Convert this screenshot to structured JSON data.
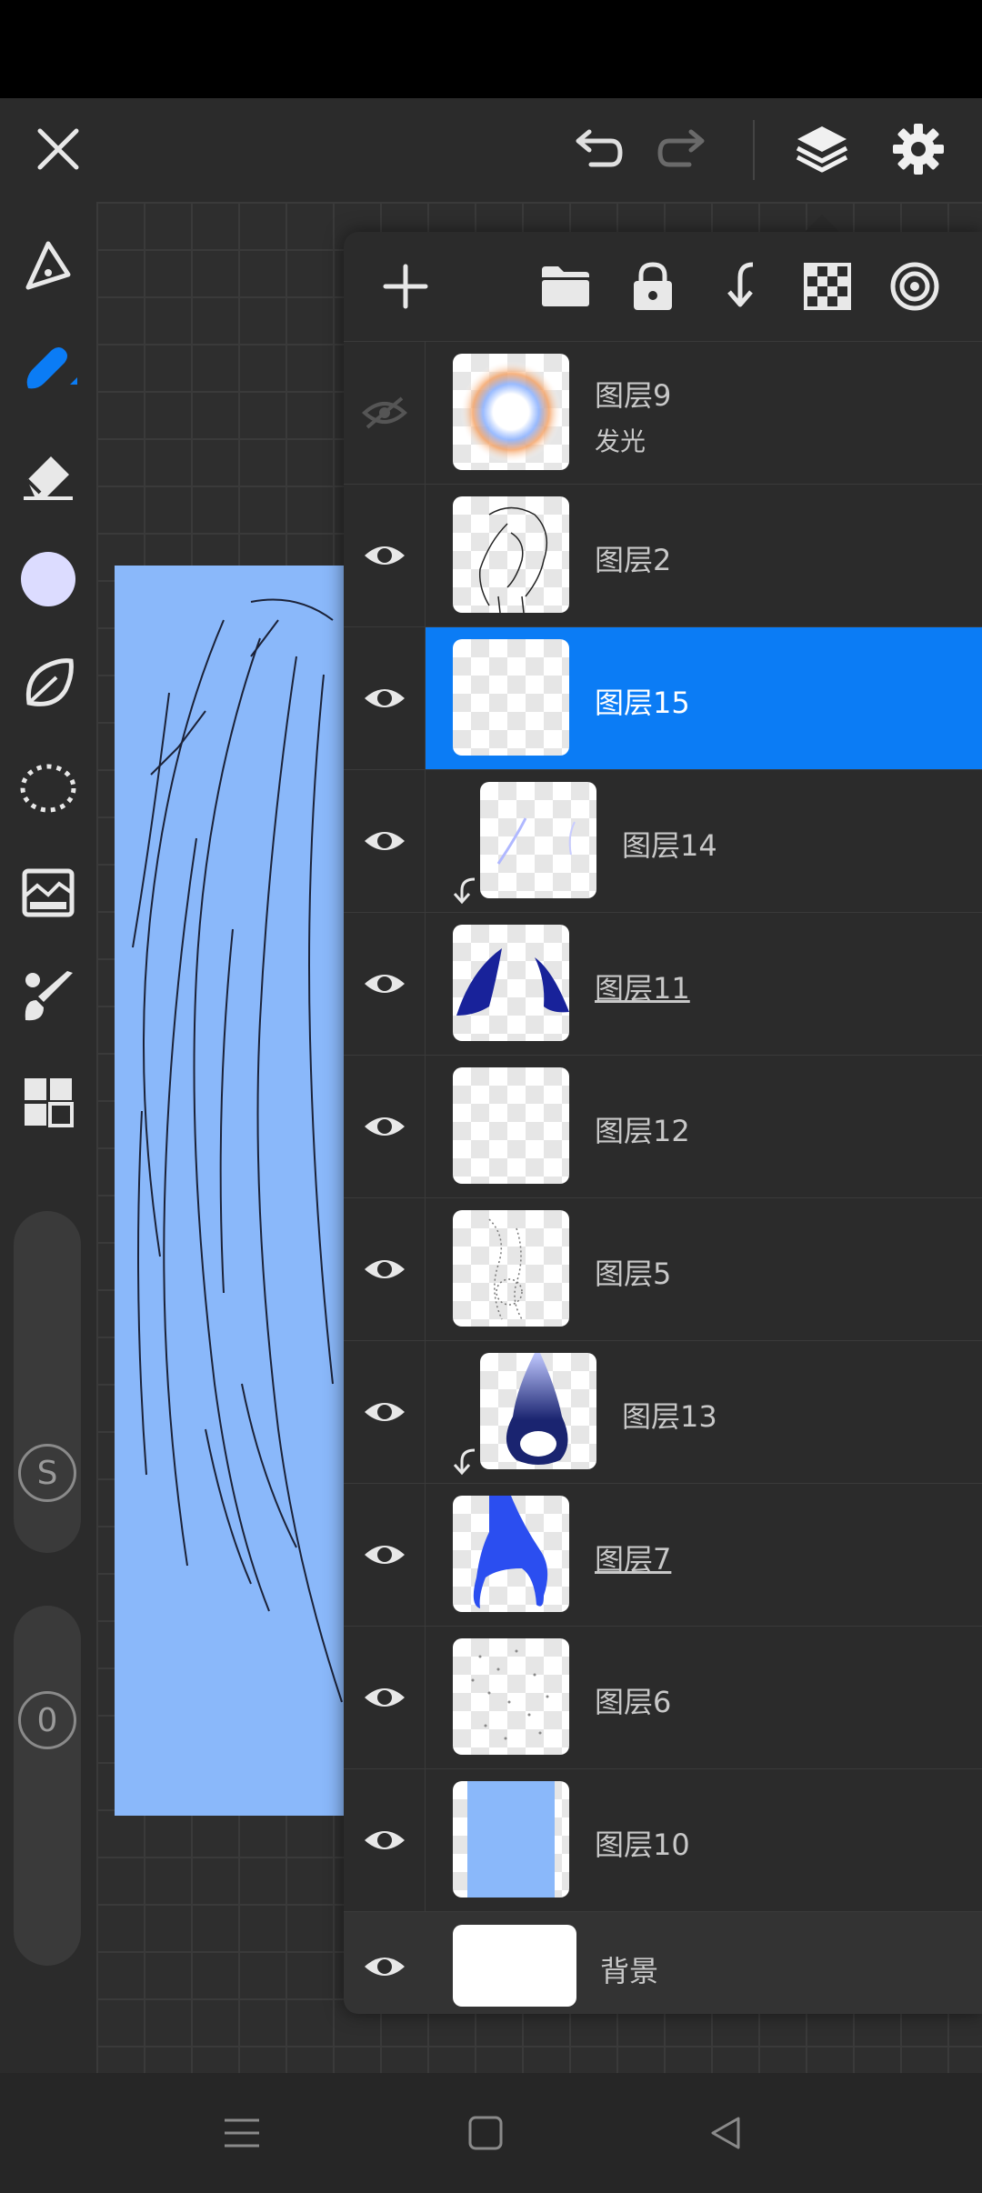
{
  "colors": {
    "accent": "#0b7cf5",
    "panel": "#2b2b2b",
    "artboard": "#8ab8fa"
  },
  "topbar": {
    "icons": [
      "close-icon",
      "undo-icon",
      "redo-icon",
      "layers-icon",
      "settings-icon"
    ]
  },
  "tools": [
    "pen-icon",
    "brush-icon",
    "eraser-icon",
    "color-swatch",
    "smudge-icon",
    "lasso-icon",
    "filter-icon",
    "paint-brush-icon",
    "grid-icon"
  ],
  "sliders": {
    "size_label": "S",
    "opacity_label": "0"
  },
  "panel_toolbar": [
    "add-icon",
    "folder-icon",
    "lock-icon",
    "merge-down-icon",
    "checker-icon",
    "blend-icon"
  ],
  "layers": [
    {
      "name": "图层9",
      "sub": "发光",
      "visible": false
    },
    {
      "name": "图层2",
      "visible": true
    },
    {
      "name": "图层15",
      "visible": true,
      "selected": true
    },
    {
      "name": "图层14",
      "visible": true,
      "clipped": true
    },
    {
      "name": "图层11",
      "visible": true,
      "underline": true
    },
    {
      "name": "图层12",
      "visible": true
    },
    {
      "name": "图层5",
      "visible": true
    },
    {
      "name": "图层13",
      "visible": true,
      "clipped": true
    },
    {
      "name": "图层7",
      "visible": true,
      "underline": true
    },
    {
      "name": "图层6",
      "visible": true
    },
    {
      "name": "图层10",
      "visible": true
    },
    {
      "name": "背景",
      "visible": true,
      "background": true
    }
  ]
}
